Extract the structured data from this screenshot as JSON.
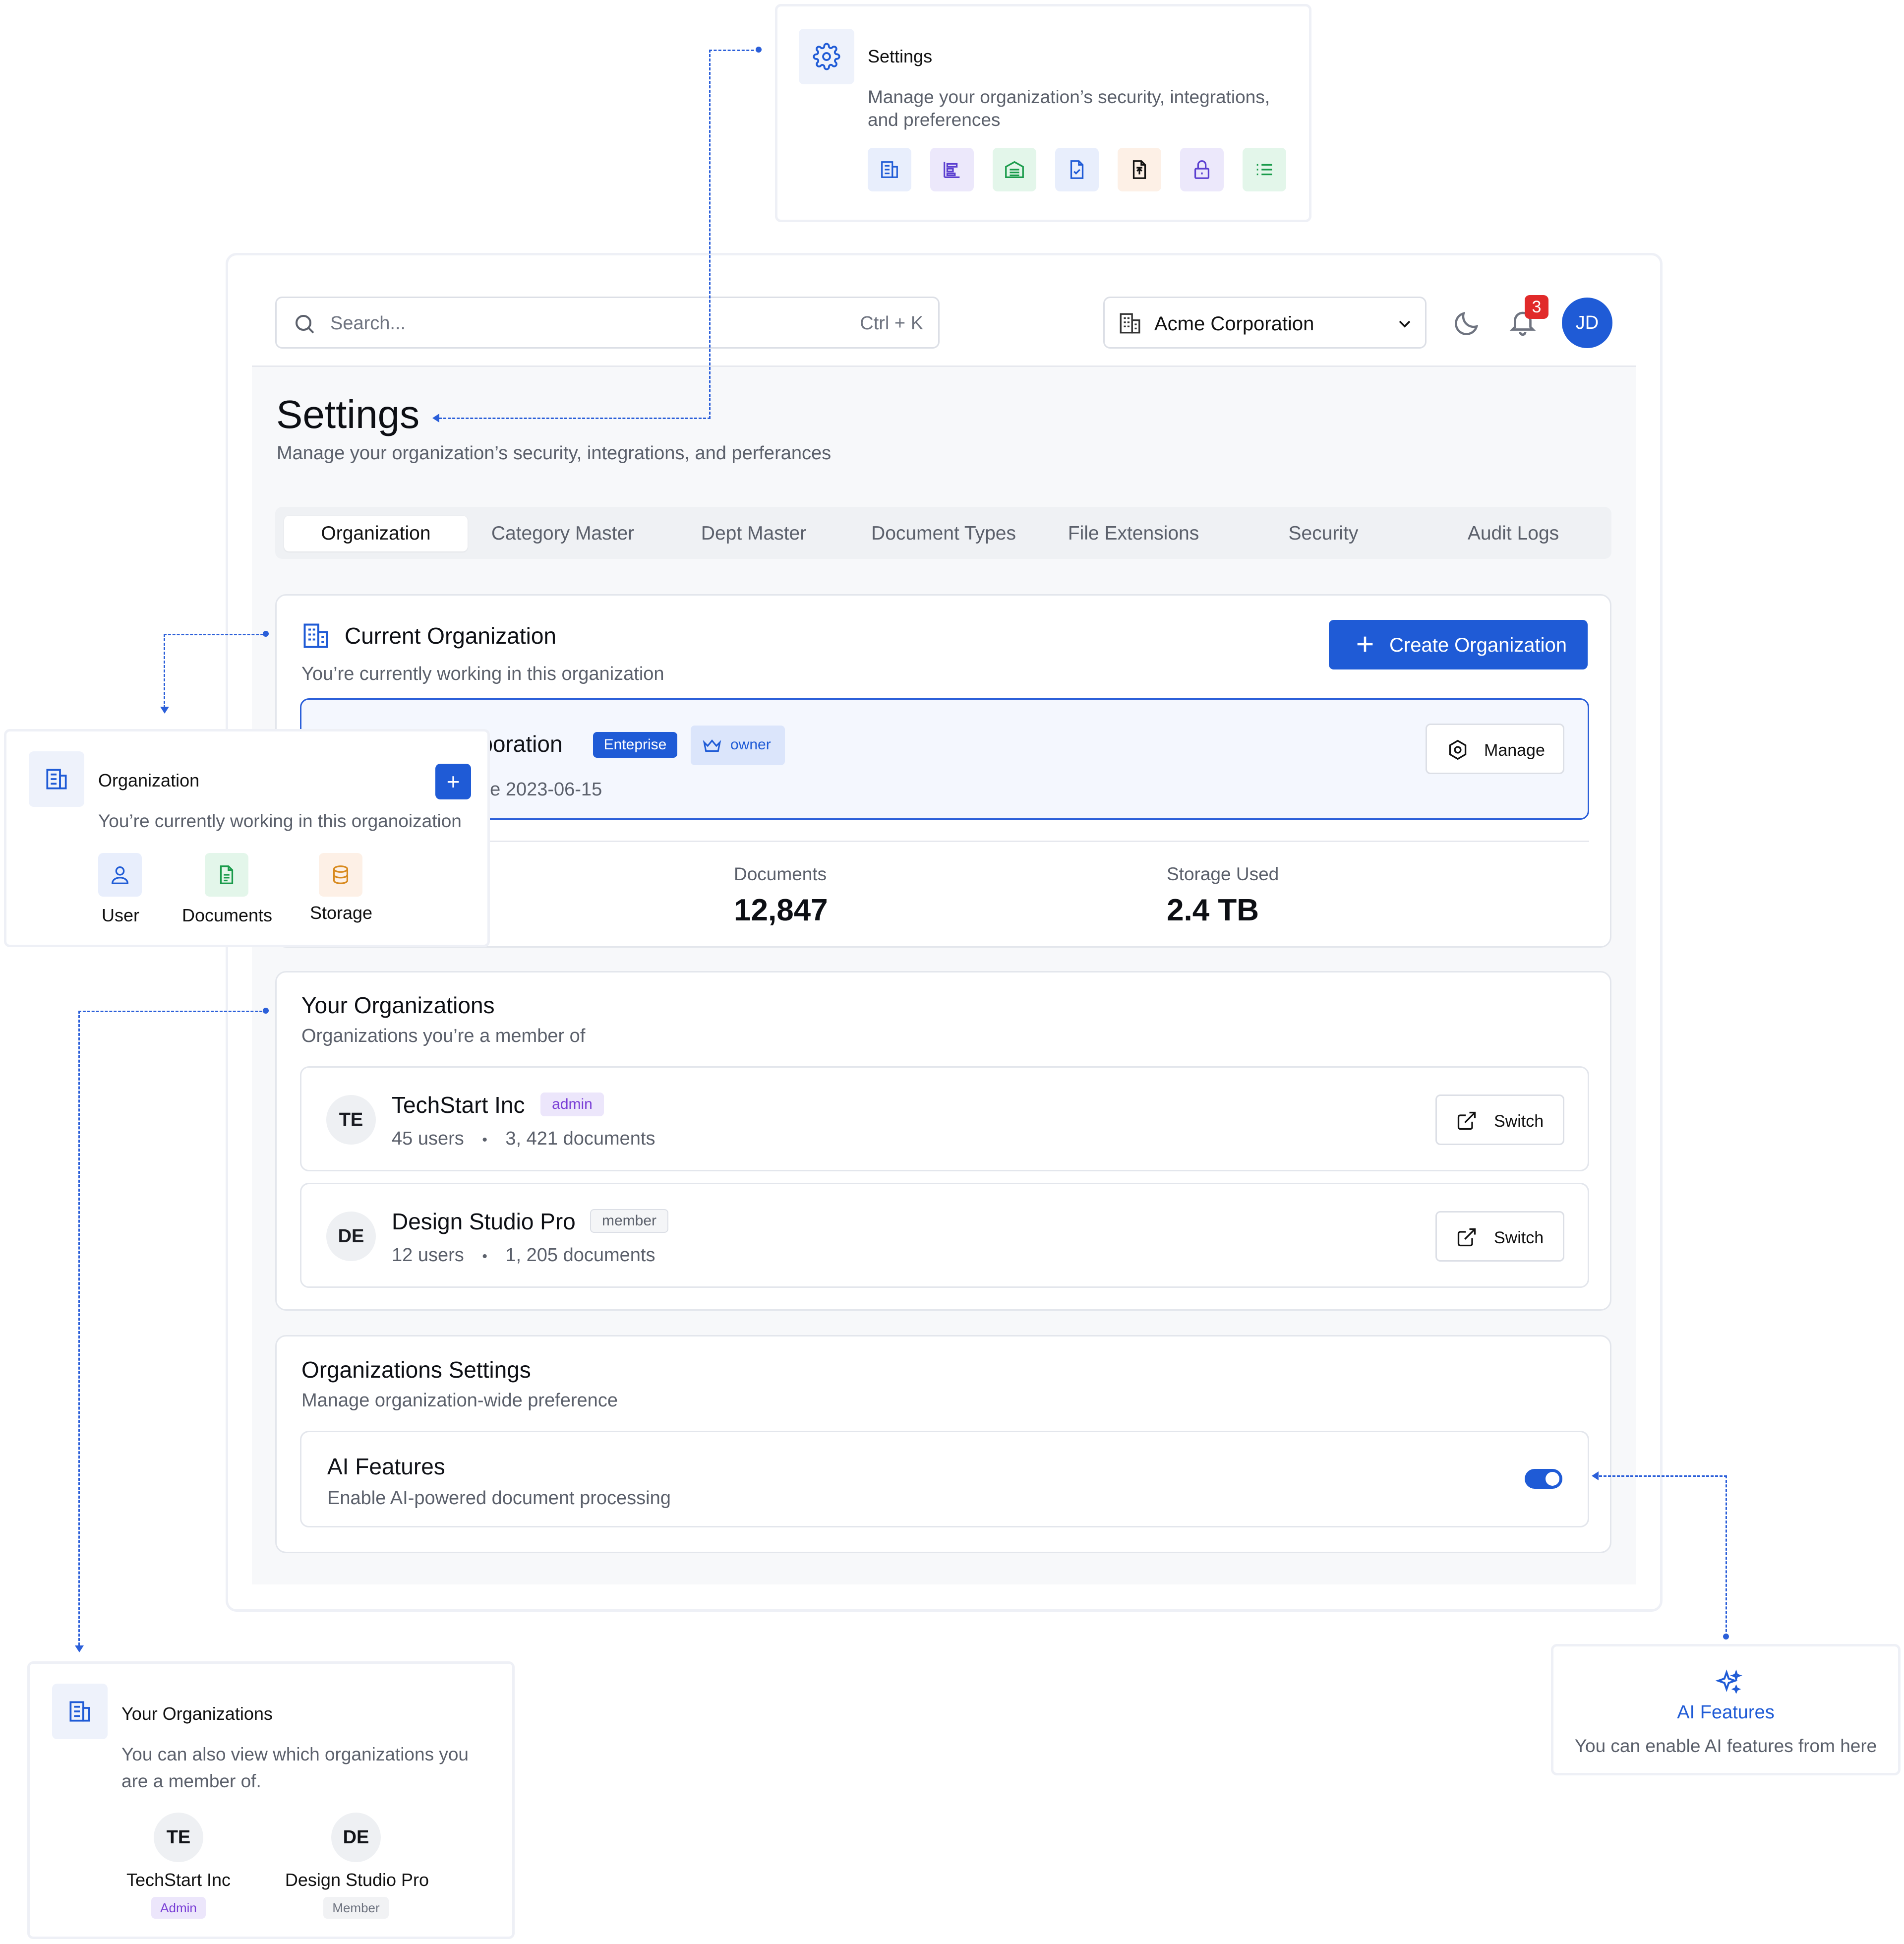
{
  "callouts": {
    "settings": {
      "title": "Settings",
      "description": "Manage your organization’s security, integrations, and preferences"
    },
    "organization": {
      "title": "Organization",
      "description": "You’re currently working in this organoization",
      "add_label": "+",
      "items": [
        {
          "label": "User",
          "icon": "user-icon"
        },
        {
          "label": "Documents",
          "icon": "document-icon"
        },
        {
          "label": "Storage",
          "icon": "database-icon"
        }
      ]
    },
    "your_organizations": {
      "title": "Your Organizations",
      "description_line1": "You can also view which organizations you",
      "description_line2": "are a member of.",
      "orgs": [
        {
          "initials": "TE",
          "name": "TechStart Inc",
          "role": "Admin"
        },
        {
          "initials": "DE",
          "name": "Design Studio Pro",
          "role": "Member"
        }
      ]
    },
    "ai_features": {
      "title": "AI Features",
      "description": "You can enable AI features from here"
    }
  },
  "topbar": {
    "search_placeholder": "Search...",
    "search_shortcut": "Ctrl + K",
    "org_selector": "Acme Corporation",
    "notification_count": "3",
    "user_initials": "JD"
  },
  "header": {
    "title": "Settings",
    "subtitle": "Manage your organization’s security, integrations, and perferances"
  },
  "tabs": [
    {
      "label": "Organization",
      "active": true
    },
    {
      "label": "Category Master"
    },
    {
      "label": "Dept Master"
    },
    {
      "label": "Document Types"
    },
    {
      "label": "File Extensions"
    },
    {
      "label": "Security"
    },
    {
      "label": "Audit Logs"
    }
  ],
  "current_org": {
    "title": "Current Organization",
    "subtitle": "You’re currently working in this organization",
    "create_button": "Create Organization",
    "name_visible": "rporation",
    "plan_badge": "Enteprise",
    "role_badge": "owner",
    "since_visible": "nce 2023-06-15",
    "manage_button": "Manage",
    "stats": [
      {
        "label": "Documents",
        "value": "12,847"
      },
      {
        "label": "Storage Used",
        "value": "2.4 TB"
      }
    ]
  },
  "your_orgs": {
    "title": "Your Organizations",
    "subtitle": "Organizations you’re a member of",
    "items": [
      {
        "initials": "TE",
        "name": "TechStart Inc",
        "role": "admin",
        "users": "45 users",
        "documents": "3, 421 documents",
        "action": "Switch"
      },
      {
        "initials": "DE",
        "name": "Design Studio Pro",
        "role": "member",
        "users": "12 users",
        "documents": "1, 205 documents",
        "action": "Switch"
      }
    ]
  },
  "org_settings": {
    "title": "Organizations Settings",
    "subtitle": "Manage organization-wide preference",
    "ai": {
      "title": "AI Features",
      "description": "Enable AI-powered document processing",
      "enabled": true
    }
  },
  "colors": {
    "accent": "#1f5bd6",
    "connector": "#2b5fd9",
    "badge_red": "#e12a2a",
    "admin_bg": "#ece6fb",
    "admin_text": "#7a3fd6"
  }
}
